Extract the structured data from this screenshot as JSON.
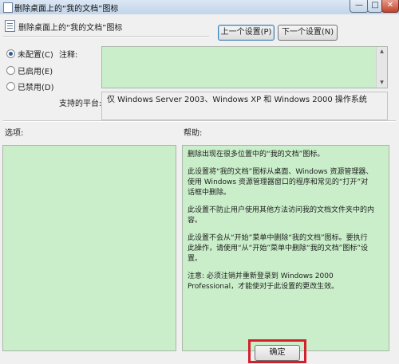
{
  "window": {
    "title": "删除桌面上的“我的文档”图标",
    "minimize_icon": "minimize-icon",
    "maximize_icon": "maximize-icon",
    "close_icon": "close-icon"
  },
  "header": {
    "title": "删除桌面上的“我的文档”图标",
    "prev_button": "上一个设置(P)",
    "next_button": "下一个设置(N)"
  },
  "state": {
    "options": [
      {
        "label": "未配置(C)",
        "selected": true
      },
      {
        "label": "已启用(E)",
        "selected": false
      },
      {
        "label": "已禁用(D)",
        "selected": false
      }
    ]
  },
  "comment": {
    "label": "注释:",
    "value": ""
  },
  "platform": {
    "label": "支持的平台:",
    "value": "仅 Windows Server 2003、Windows XP 和 Windows 2000 操作系统"
  },
  "options_pane": {
    "label": "选项:"
  },
  "help_pane": {
    "label": "帮助:",
    "paragraphs": [
      "删除出现在很多位置中的“我的文档”图标。",
      "此设置将“我的文档”图标从桌面、Windows 资源管理器、使用 Windows 资源管理器窗口的程序和常见的“打开”对话框中删除。",
      "此设置不防止用户使用其他方法访问我的文档文件夹中的内容。",
      "此设置不会从“开始”菜单中删除“我的文档”图标。要执行此操作，请使用“从“开始”菜单中删除“我的文档”图标”设置。",
      "注意: 必须注销并重新登录到 Windows 2000 Professional，才能使对于此设置的更改生效。"
    ]
  },
  "footer": {
    "ok_button": "确定"
  },
  "colors": {
    "pane_background": "#c9eec9",
    "highlight": "#d4202a",
    "dialog_background": "#f0f0f0"
  }
}
